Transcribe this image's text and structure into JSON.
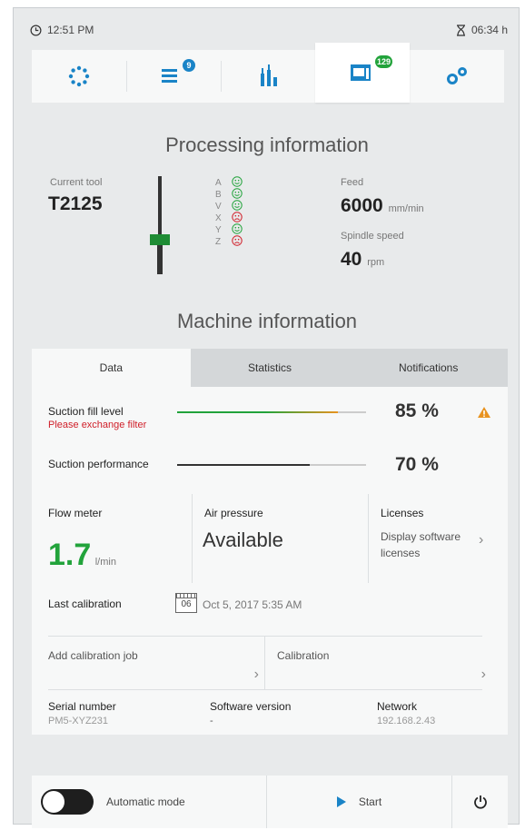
{
  "status": {
    "time": "12:51 PM",
    "runtime": "06:34 h"
  },
  "nav": {
    "tabs": [
      {
        "name": "tool-magazine",
        "icon": "tool-magazine-icon",
        "badge": ""
      },
      {
        "name": "job-list",
        "icon": "job-list-icon",
        "badge": "9"
      },
      {
        "name": "tools",
        "icon": "tools-icon",
        "badge": ""
      },
      {
        "name": "machine",
        "icon": "machine-icon",
        "badge": "129",
        "active": true
      },
      {
        "name": "settings",
        "icon": "settings-icon",
        "badge": ""
      }
    ],
    "accent": "#1a84c7"
  },
  "processing": {
    "title": "Processing information",
    "current_tool_label": "Current tool",
    "current_tool": "T2125",
    "axes": [
      {
        "label": "A",
        "state": "ok"
      },
      {
        "label": "B",
        "state": "ok"
      },
      {
        "label": "V",
        "state": "ok"
      },
      {
        "label": "X",
        "state": "bad"
      },
      {
        "label": "Y",
        "state": "ok"
      },
      {
        "label": "Z",
        "state": "bad"
      }
    ],
    "feed_label": "Feed",
    "feed_value": "6000",
    "feed_unit": "mm/min",
    "spindle_label": "Spindle speed",
    "spindle_value": "40",
    "spindle_unit": "rpm"
  },
  "machine": {
    "title": "Machine information",
    "tabs": [
      "Data",
      "Statistics",
      "Notifications"
    ],
    "suction_fill_label": "Suction fill level",
    "suction_fill_warning": "Please exchange filter",
    "suction_fill_value": "85 %",
    "suction_fill_fraction": 0.85,
    "suction_perf_label": "Suction performance",
    "suction_perf_value": "70 %",
    "suction_perf_fraction": 0.7,
    "flow_label": "Flow meter",
    "flow_value": "1.7",
    "flow_unit": "l/min",
    "air_label": "Air pressure",
    "air_value": "Available",
    "licenses_label": "Licenses",
    "licenses_link_1": "Display software",
    "licenses_link_2": "licenses",
    "last_cal_label": "Last calibration",
    "last_cal_date": "Oct 5, 2017 5:35 AM",
    "calendar_day": "06",
    "add_cal_job": "Add calibration job",
    "calibration": "Calibration",
    "serial_label": "Serial number",
    "serial_value": "PM5-XYZ231",
    "software_label": "Software version",
    "software_value": "-",
    "network_label": "Network",
    "network_value": "192.168.2.43"
  },
  "bottom": {
    "auto_mode_label": "Automatic mode",
    "start_label": "Start"
  },
  "colors": {
    "green": "#22a33b",
    "red": "#d0202a",
    "orange": "#e89320",
    "blue": "#1a84c7"
  }
}
